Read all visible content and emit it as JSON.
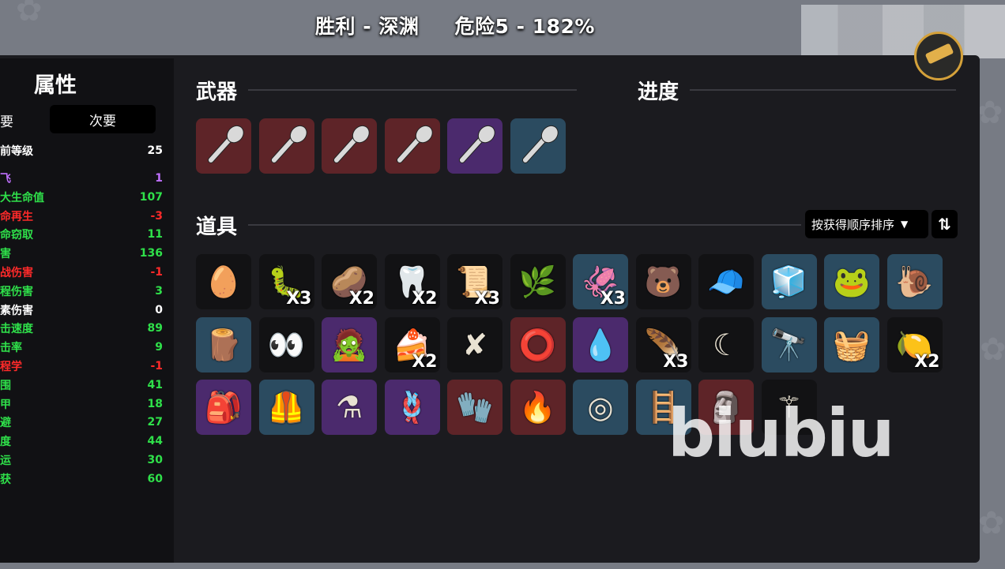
{
  "header": {
    "result": "胜利 - 深渊",
    "danger": "危险5 - 182%"
  },
  "stats": {
    "title": "属性",
    "tab_primary": "要",
    "tab_secondary": "次要",
    "rows": [
      {
        "label": "前等级",
        "value": "25",
        "color": "#ffffff"
      },
      {
        "label": "飞",
        "value": "1",
        "color": "#c070ff"
      },
      {
        "label": "大生命值",
        "value": "107",
        "color": "#2fe04a"
      },
      {
        "label": "命再生",
        "value": "-3",
        "color": "#ff2a2a"
      },
      {
        "label": "命窃取",
        "value": "11",
        "color": "#2fe04a"
      },
      {
        "label": "害",
        "value": "136",
        "color": "#2fe04a"
      },
      {
        "label": "战伤害",
        "value": "-1",
        "color": "#ff2a2a"
      },
      {
        "label": "程伤害",
        "value": "3",
        "color": "#2fe04a"
      },
      {
        "label": "素伤害",
        "value": "0",
        "color": "#ffffff"
      },
      {
        "label": "击速度",
        "value": "89",
        "color": "#2fe04a"
      },
      {
        "label": "击率",
        "value": "9",
        "color": "#2fe04a"
      },
      {
        "label": "程学",
        "value": "-1",
        "color": "#ff2a2a"
      },
      {
        "label": "围",
        "value": "41",
        "color": "#2fe04a"
      },
      {
        "label": "甲",
        "value": "18",
        "color": "#2fe04a"
      },
      {
        "label": "避",
        "value": "27",
        "color": "#2fe04a"
      },
      {
        "label": "度",
        "value": "44",
        "color": "#2fe04a"
      },
      {
        "label": "运",
        "value": "30",
        "color": "#2fe04a"
      },
      {
        "label": "获",
        "value": "60",
        "color": "#2fe04a"
      }
    ]
  },
  "weapons": {
    "label": "武器",
    "items": [
      {
        "icon": "spoon-icon",
        "tier": "red"
      },
      {
        "icon": "spoon-icon",
        "tier": "red"
      },
      {
        "icon": "spoon-icon",
        "tier": "red"
      },
      {
        "icon": "spoon-icon",
        "tier": "red"
      },
      {
        "icon": "spoon-icon",
        "tier": "purple"
      },
      {
        "icon": "spoon-icon",
        "tier": "blue"
      }
    ]
  },
  "progress": {
    "label": "进度"
  },
  "items": {
    "label": "道具",
    "sort_label": "按获得顺序排序",
    "sort_toggle": "⇅",
    "rows": [
      [
        {
          "icon": "egg-mustache-icon",
          "glyph": "🥚",
          "tier": "common",
          "count": ""
        },
        {
          "icon": "worm-icon",
          "glyph": "🐛",
          "tier": "common",
          "count": "X3"
        },
        {
          "icon": "potato-face-icon",
          "glyph": "🥔",
          "tier": "common",
          "count": "X2"
        },
        {
          "icon": "fang-icon",
          "glyph": "🦷",
          "tier": "common",
          "count": "X2"
        },
        {
          "icon": "scroll-icon",
          "glyph": "📜",
          "tier": "common",
          "count": "X3"
        },
        {
          "icon": "herb-sack-icon",
          "glyph": "🌿",
          "tier": "common",
          "count": ""
        },
        {
          "icon": "tentacle-icon",
          "glyph": "🦑",
          "tier": "blue",
          "count": "X3"
        },
        {
          "icon": "bear-icon",
          "glyph": "🐻",
          "tier": "common",
          "count": ""
        },
        {
          "icon": "beanie-icon",
          "glyph": "🧢",
          "tier": "common",
          "count": ""
        },
        {
          "icon": "ice-cube-icon",
          "glyph": "🧊",
          "tier": "blue",
          "count": ""
        },
        {
          "icon": "frog-icon",
          "glyph": "🐸",
          "tier": "blue",
          "count": ""
        },
        {
          "icon": "snail-icon",
          "glyph": "🐌",
          "tier": "blue",
          "count": ""
        }
      ],
      [
        {
          "icon": "wood-plank-icon",
          "glyph": "🪵",
          "tier": "blue",
          "count": ""
        },
        {
          "icon": "glowing-eyes-icon",
          "glyph": "👀",
          "tier": "common",
          "count": ""
        },
        {
          "icon": "zombie-head-icon",
          "glyph": "🧟",
          "tier": "purple",
          "count": ""
        },
        {
          "icon": "cake-slice-icon",
          "glyph": "🍰",
          "tier": "common",
          "count": "X2"
        },
        {
          "icon": "red-branch-icon",
          "glyph": "✘",
          "tier": "common",
          "count": ""
        },
        {
          "icon": "belt-icon",
          "glyph": "⭕",
          "tier": "red",
          "count": ""
        },
        {
          "icon": "blue-slime-icon",
          "glyph": "💧",
          "tier": "purple",
          "count": ""
        },
        {
          "icon": "feather-icon",
          "glyph": "🪶",
          "tier": "common",
          "count": "X3"
        },
        {
          "icon": "crescent-icon",
          "glyph": "☾",
          "tier": "common",
          "count": ""
        },
        {
          "icon": "spyglass-icon",
          "glyph": "🔭",
          "tier": "blue",
          "count": ""
        },
        {
          "icon": "basket-icon",
          "glyph": "🧺",
          "tier": "blue",
          "count": ""
        },
        {
          "icon": "lemonade-icon",
          "glyph": "🍋",
          "tier": "common",
          "count": "X2"
        }
      ],
      [
        {
          "icon": "cloth-sack-icon",
          "glyph": "🎒",
          "tier": "purple",
          "count": ""
        },
        {
          "icon": "vest-icon",
          "glyph": "🦺",
          "tier": "blue",
          "count": ""
        },
        {
          "icon": "potion-gadget-icon",
          "glyph": "⚗",
          "tier": "purple",
          "count": ""
        },
        {
          "icon": "rope-knot-icon",
          "glyph": "🪢",
          "tier": "purple",
          "count": ""
        },
        {
          "icon": "bloody-glove-icon",
          "glyph": "🧤",
          "tier": "red",
          "count": ""
        },
        {
          "icon": "torch-icon",
          "glyph": "🔥",
          "tier": "red",
          "count": ""
        },
        {
          "icon": "stone-circle-icon",
          "glyph": "◎",
          "tier": "blue",
          "count": ""
        },
        {
          "icon": "green-ladder-icon",
          "glyph": "🪜",
          "tier": "blue",
          "count": ""
        },
        {
          "icon": "gold-idol-icon",
          "glyph": "🗿",
          "tier": "red",
          "count": ""
        },
        {
          "icon": "scythe-icon",
          "glyph": "⚚",
          "tier": "common",
          "count": ""
        }
      ]
    ]
  },
  "watermark": "biubiu"
}
